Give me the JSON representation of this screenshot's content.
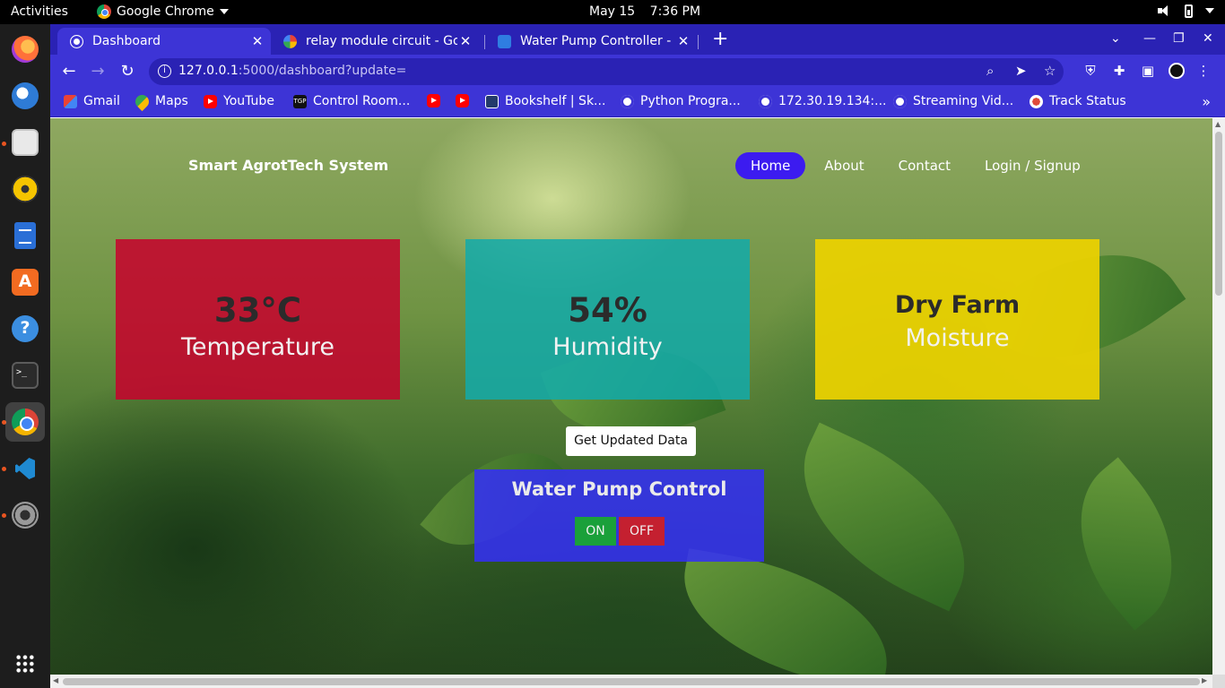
{
  "topbar": {
    "activities": "Activities",
    "app_name": "Google Chrome",
    "date": "May 15",
    "time": "7:36 PM"
  },
  "dock": {
    "items": [
      "firefox-icon",
      "thunderbird-icon",
      "files-icon",
      "rhythmbox-icon",
      "libreoffice-writer-icon",
      "software-center-icon",
      "help-icon",
      "terminal-icon",
      "chrome-icon",
      "vscode-icon",
      "settings-icon",
      "show-apps-icon"
    ]
  },
  "browser": {
    "tabs": [
      {
        "title": "Dashboard",
        "favicon": "globe-icon"
      },
      {
        "title": "relay module circuit - Google Search",
        "favicon": "google-icon"
      },
      {
        "title": "Water Pump Controller - Hackster.io",
        "favicon": "hash-icon"
      }
    ],
    "url_host": "127.0.0.1",
    "url_path": ":5000/dashboard?update=",
    "bookmarks": [
      {
        "label": "Gmail",
        "icon": "gmail"
      },
      {
        "label": "Maps",
        "icon": "maps"
      },
      {
        "label": "YouTube",
        "icon": "yt"
      },
      {
        "label": "Control Room...",
        "icon": "tgp"
      },
      {
        "label": "",
        "icon": "yt"
      },
      {
        "label": "",
        "icon": "yt"
      },
      {
        "label": "Bookshelf | Sk...",
        "icon": "book"
      },
      {
        "label": "Python Progra...",
        "icon": "globe"
      },
      {
        "label": "172.30.19.134:...",
        "icon": "globe"
      },
      {
        "label": "Streaming Vid...",
        "icon": "globe"
      },
      {
        "label": "Track Status",
        "icon": "track"
      }
    ]
  },
  "page": {
    "brand": "Smart AgrotTech System",
    "nav": [
      "Home",
      "About",
      "Contact",
      "Login / Signup"
    ],
    "nav_active": "Home",
    "cards": {
      "temperature": {
        "value": "33°C",
        "label": "Temperature"
      },
      "humidity": {
        "value": "54%",
        "label": "Humidity"
      },
      "moisture": {
        "value": "Dry Farm",
        "label": "Moisture"
      }
    },
    "update_button": "Get Updated Data",
    "pump": {
      "title": "Water Pump Control",
      "on_label": "ON",
      "off_label": "OFF"
    }
  },
  "colors": {
    "chrome_theme": "#3d34d6",
    "temperature_card": "#c8002d",
    "humidity_card": "#12aaaa",
    "moisture_card": "#ecd200",
    "pump_panel": "#342ef8",
    "nav_active": "#3c1bf0",
    "on_button": "#1aa03a",
    "off_button": "#c42030"
  }
}
